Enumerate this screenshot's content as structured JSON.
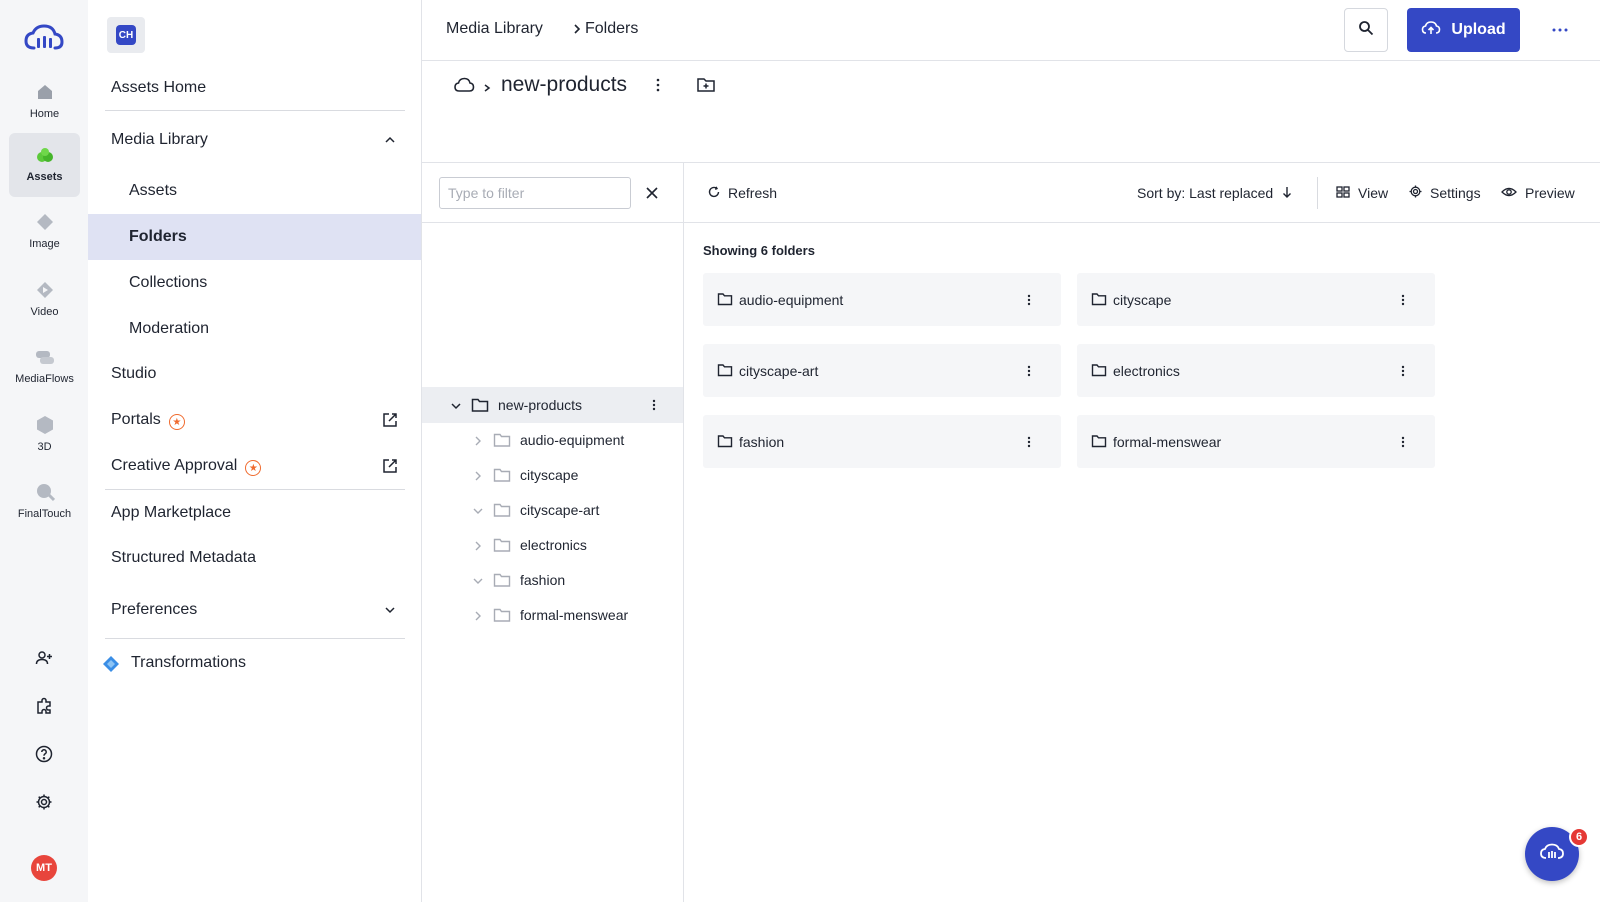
{
  "rail": {
    "items": [
      {
        "label": "Home",
        "icon": "home-icon"
      },
      {
        "label": "Assets",
        "icon": "assets-icon",
        "active": true
      },
      {
        "label": "Image",
        "icon": "image-icon"
      },
      {
        "label": "Video",
        "icon": "video-icon"
      },
      {
        "label": "MediaFlows",
        "icon": "mediaflows-icon"
      },
      {
        "label": "3D",
        "icon": "3d-icon"
      },
      {
        "label": "FinalTouch",
        "icon": "finaltouch-icon"
      }
    ],
    "bottom_icons": [
      "add-user-icon",
      "puzzle-icon",
      "help-icon",
      "settings-icon"
    ],
    "avatar": "MT"
  },
  "cloud_badge": "CH",
  "nav": {
    "assets_home": "Assets Home",
    "media_library": "Media Library",
    "assets": "Assets",
    "folders": "Folders",
    "collections": "Collections",
    "moderation": "Moderation",
    "studio": "Studio",
    "portals": "Portals",
    "creative_approval": "Creative Approval",
    "app_marketplace": "App Marketplace",
    "structured_metadata": "Structured Metadata",
    "preferences": "Preferences",
    "transformations": "Transformations"
  },
  "topbar": {
    "breadcrumb": [
      "Media Library",
      "Folders"
    ],
    "upload_label": "Upload"
  },
  "folder": {
    "title": "new-products"
  },
  "tree": {
    "filter_placeholder": "Type to filter",
    "root": "new-products",
    "children": [
      {
        "label": "audio-equipment",
        "expanded": false
      },
      {
        "label": "cityscape",
        "expanded": false
      },
      {
        "label": "cityscape-art",
        "expanded": true
      },
      {
        "label": "electronics",
        "expanded": false
      },
      {
        "label": "fashion",
        "expanded": true
      },
      {
        "label": "formal-menswear",
        "expanded": false
      }
    ]
  },
  "toolbar": {
    "refresh": "Refresh",
    "sort": "Sort by: Last replaced",
    "view": "View",
    "settings": "Settings",
    "preview": "Preview"
  },
  "content": {
    "showing": "Showing 6 folders",
    "folders": [
      "audio-equipment",
      "cityscape",
      "cityscape-art",
      "electronics",
      "fashion",
      "formal-menswear"
    ]
  },
  "fab": {
    "badge_count": "6"
  },
  "colors": {
    "accent": "#3448c5",
    "selected_nav": "#dfe2f3",
    "badge_orange": "#f06b2f",
    "avatar_red": "#e8453c"
  }
}
